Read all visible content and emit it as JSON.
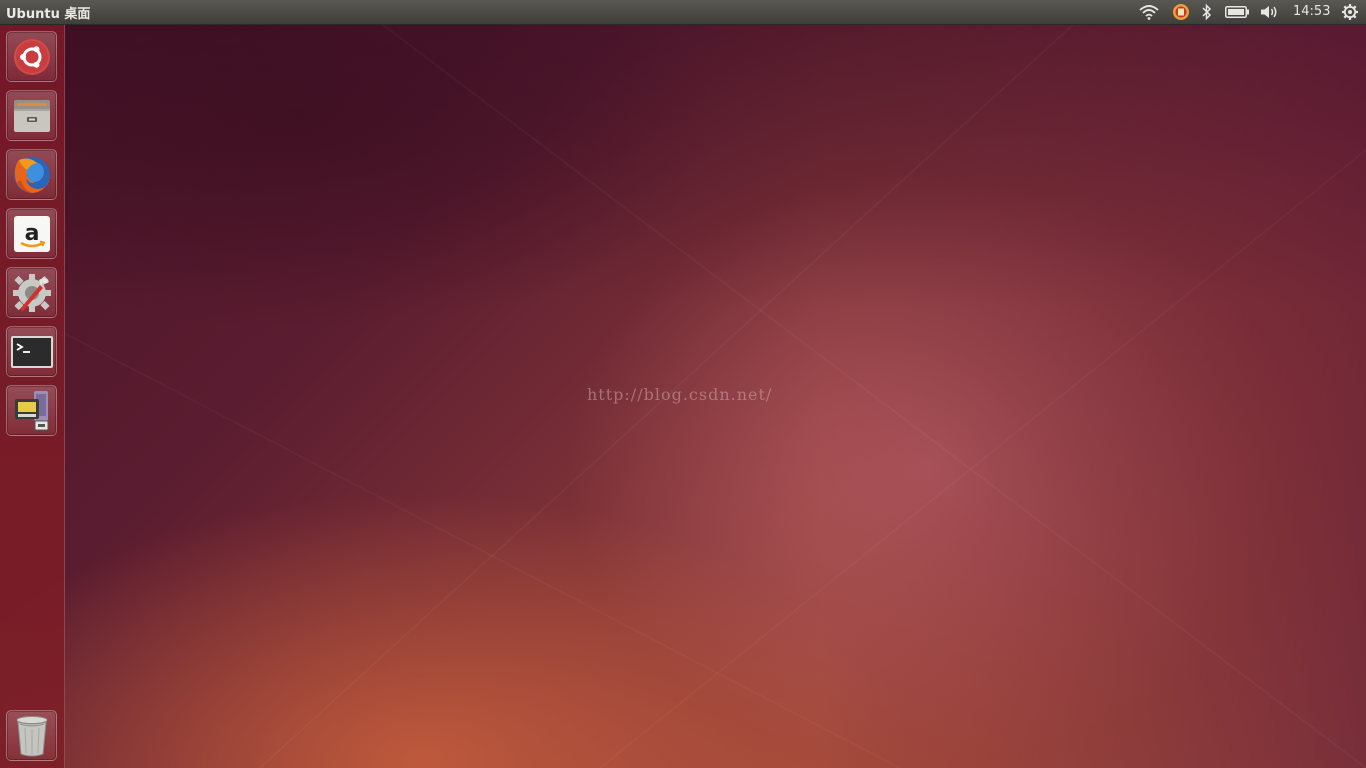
{
  "top_panel": {
    "window_title": "Ubuntu 桌面",
    "clock": "14:53",
    "indicators": [
      "wifi-icon",
      "input-method-icon",
      "bluetooth-icon",
      "battery-icon",
      "volume-icon",
      "session-gear-icon"
    ]
  },
  "launcher": {
    "items": [
      {
        "name": "dash-home",
        "icon": "ubuntu-logo-icon"
      },
      {
        "name": "files",
        "icon": "file-cabinet-icon"
      },
      {
        "name": "firefox",
        "icon": "firefox-icon"
      },
      {
        "name": "amazon",
        "icon": "amazon-icon"
      },
      {
        "name": "system-settings",
        "icon": "settings-wrench-icon"
      },
      {
        "name": "terminal",
        "icon": "terminal-icon"
      },
      {
        "name": "workspace-switcher",
        "icon": "workspace-switcher-icon"
      },
      {
        "name": "trash",
        "icon": "trash-icon"
      }
    ]
  },
  "desktop": {
    "watermark": "http://blog.csdn.net/"
  },
  "colors": {
    "panel_bg": "#3f3e3a",
    "launcher_bg": "#7c1a28",
    "wallpaper_dark": "#4a1427",
    "wallpaper_orange": "#b65b43"
  }
}
